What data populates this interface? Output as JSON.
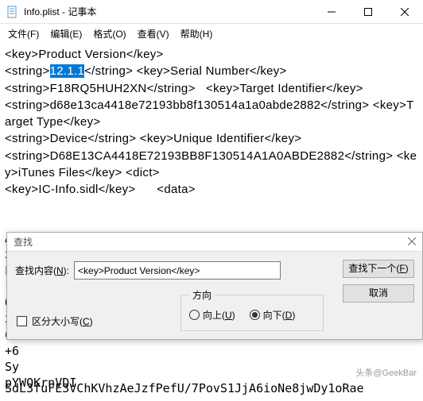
{
  "window": {
    "title": "Info.plist - 记事本",
    "min_label": "minimize",
    "max_label": "maximize",
    "close_label": "close"
  },
  "menu": {
    "file": "文件(F)",
    "edit": "编辑(E)",
    "format": "格式(O)",
    "view": "查看(V)",
    "help": "帮助(H)"
  },
  "editor": {
    "pre1": "<key>Product Version</key>\n<string>",
    "selected": "12.1.1",
    "post1": "</string> <key>Serial Number</key>\n<string>F18RQ5HUH2XN</string>   <key>Target Identifier</key>\n<string>d68e13ca4418e72193bb8f130514a1a0abde2882</string> <key>Target Type</key>\n<string>Device</string> <key>Unique Identifier</key>\n<string>D68E13CA4418E72193BB8F130514A1A0ABDE2882</string> <key>iTunes Files</key> <dict>\n<key>IC-Info.sidl</key>      <data>",
    "bglines": "AA\nxm\nLh\n1\nQ.\nx0\nC8\n+6\nSy\npYWOKrnVDI",
    "footer": "SdL3fuFE3VChKVhzAeJzfPefU/7PovS1JjA6ioNe8jwDy1oRae"
  },
  "find": {
    "title": "查找",
    "label": "查找内容(N):",
    "value": "<key>Product Version</key>",
    "next_btn": "查找下一个(F)",
    "cancel_btn": "取消",
    "direction_label": "方向",
    "up_label": "向上(U)",
    "down_label": "向下(D)",
    "case_label": "区分大小写(C)"
  },
  "watermark": "头条@GeekBar"
}
